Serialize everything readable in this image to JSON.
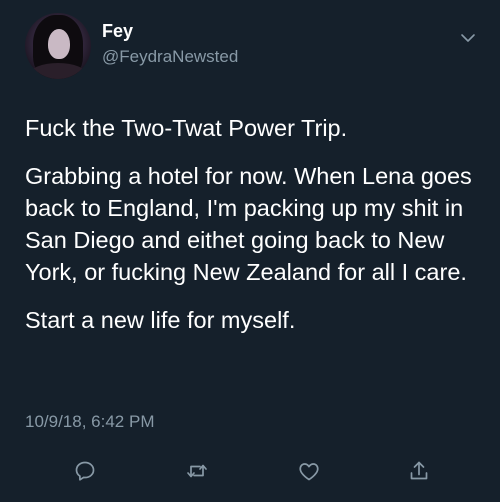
{
  "tweet": {
    "display_name": "Fey",
    "handle": "@FeydraNewsted",
    "paragraphs": [
      "Fuck the Two-Twat Power Trip.",
      "Grabbing a hotel for now. When Lena goes back to England, I'm packing up my shit in San Diego and eithet going back to New York, or fucking New Zealand for all I care.",
      "Start a new life for myself."
    ],
    "timestamp": "10/9/18, 6:42 PM"
  },
  "actions": [
    {
      "icon": "reply-icon"
    },
    {
      "icon": "retweet-icon"
    },
    {
      "icon": "like-icon"
    },
    {
      "icon": "share-icon"
    }
  ],
  "colors": {
    "background": "#15202b",
    "primary_text": "#ffffff",
    "secondary_text": "#8899a6",
    "icon": "#8899a6"
  }
}
